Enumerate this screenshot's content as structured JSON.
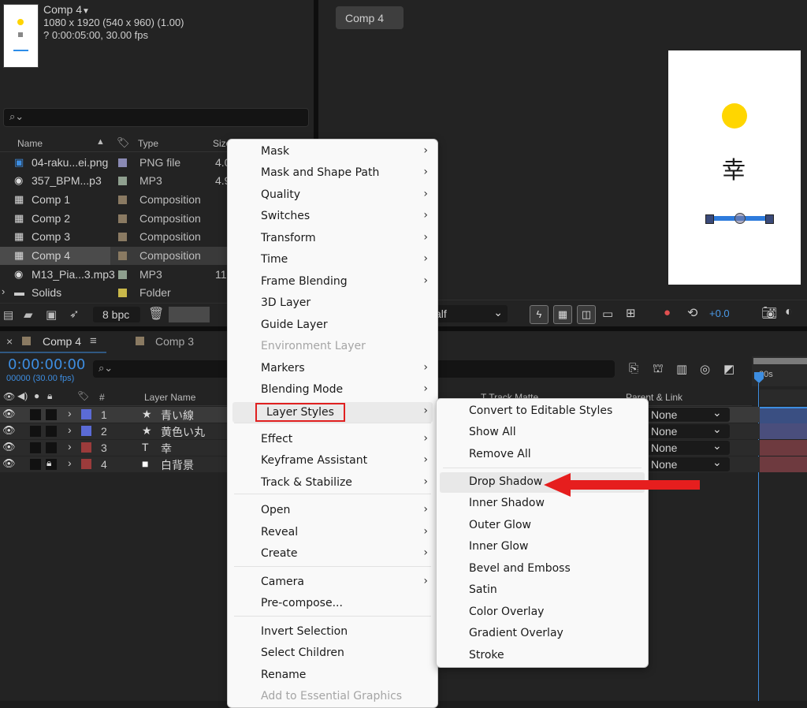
{
  "project": {
    "comp_name": "Comp 4",
    "comp_line1": "1080 x 1920  (540 x 960) (1.00)",
    "comp_line2": "? 0:00:05:00, 30.00 fps",
    "columns": {
      "name": "Name",
      "type": "Type",
      "size": "Size"
    },
    "items": [
      {
        "name": "04-raku...ei.png",
        "type": "PNG file",
        "size": "4.0",
        "swatch": "#8a8ab4",
        "icon": "png-file-icon"
      },
      {
        "name": "357_BPM...p3",
        "type": "MP3",
        "size": "4.9",
        "swatch": "#8fa08f",
        "icon": "audio-file-icon"
      },
      {
        "name": "Comp 1",
        "type": "Composition",
        "size": "",
        "swatch": "#8a7a62",
        "icon": "composition-icon"
      },
      {
        "name": "Comp 2",
        "type": "Composition",
        "size": "",
        "swatch": "#8a7a62",
        "icon": "composition-icon"
      },
      {
        "name": "Comp 3",
        "type": "Composition",
        "size": "",
        "swatch": "#8a7a62",
        "icon": "composition-icon"
      },
      {
        "name": "Comp 4",
        "type": "Composition",
        "size": "",
        "swatch": "#8a7a62",
        "icon": "composition-icon"
      },
      {
        "name": "M13_Pia...3.mp3",
        "type": "MP3",
        "size": "11",
        "swatch": "#8fa08f",
        "icon": "audio-file-icon"
      },
      {
        "name": "Solids",
        "type": "Folder",
        "size": "",
        "swatch": "#c9b84a",
        "icon": "folder-icon"
      }
    ],
    "bpc": "8 bpc"
  },
  "viewer": {
    "tab": "Comp 4",
    "glyph": "幸",
    "resolution": "alf",
    "exposure": "+0.0"
  },
  "timeline": {
    "tabs": [
      "Comp 4",
      "Comp 3"
    ],
    "timecode": "0:00:00:00",
    "frames": "00000 (30.00 fps)",
    "ruler_label": "00s",
    "headers": {
      "num": "#",
      "layer_name": "Layer Name",
      "track_matte": "T  Track Matte",
      "parent": "Parent & Link"
    },
    "layers": [
      {
        "num": "1",
        "name": "青い線",
        "label": "#5b6bd6",
        "type_icon": "star-icon",
        "parent": "None",
        "bar": "#3a4f82"
      },
      {
        "num": "2",
        "name": "黄色い丸",
        "label": "#5b6bd6",
        "type_icon": "star-icon",
        "parent": "None",
        "bar": "#4a4e7c"
      },
      {
        "num": "3",
        "name": "幸",
        "label": "#9b3b3b",
        "type_icon": "text-icon",
        "parent": "None",
        "bar": "#6e3a3f"
      },
      {
        "num": "4",
        "name": "白背景",
        "label": "#9b3b3b",
        "type_icon": "solid-icon",
        "parent": "None",
        "bar": "#6e3a3f"
      }
    ]
  },
  "context_menu": {
    "items": [
      {
        "label": "Mask",
        "sub": true
      },
      {
        "label": "Mask and Shape Path",
        "sub": true
      },
      {
        "label": "Quality",
        "sub": true
      },
      {
        "label": "Switches",
        "sub": true
      },
      {
        "label": "Transform",
        "sub": true
      },
      {
        "label": "Time",
        "sub": true
      },
      {
        "label": "Frame Blending",
        "sub": true
      },
      {
        "label": "3D Layer",
        "sub": false
      },
      {
        "label": "Guide Layer",
        "sub": false
      },
      {
        "label": "Environment Layer",
        "sub": false,
        "disabled": true
      },
      {
        "label": "Markers",
        "sub": true
      },
      {
        "label": "Blending Mode",
        "sub": true
      },
      {
        "label": "Layer Styles",
        "sub": true,
        "highlight": true
      },
      {
        "label": "Effect",
        "sub": true
      },
      {
        "label": "Keyframe Assistant",
        "sub": true
      },
      {
        "label": "Track & Stabilize",
        "sub": true
      },
      {
        "label": "Open",
        "sub": true
      },
      {
        "label": "Reveal",
        "sub": true
      },
      {
        "label": "Create",
        "sub": true
      },
      {
        "label": "Camera",
        "sub": true
      },
      {
        "label": "Pre-compose...",
        "sub": false
      },
      {
        "label": "Invert Selection",
        "sub": false
      },
      {
        "label": "Select Children",
        "sub": false
      },
      {
        "label": "Rename",
        "sub": false
      },
      {
        "label": "Add to Essential Graphics",
        "sub": false,
        "disabled": true
      }
    ]
  },
  "layer_styles_menu": {
    "items": [
      {
        "label": "Convert to Editable Styles"
      },
      {
        "label": "Show All"
      },
      {
        "label": "Remove All"
      },
      {
        "label": "Drop Shadow",
        "hover": true
      },
      {
        "label": "Inner Shadow"
      },
      {
        "label": "Outer Glow"
      },
      {
        "label": "Inner Glow"
      },
      {
        "label": "Bevel and Emboss"
      },
      {
        "label": "Satin"
      },
      {
        "label": "Color Overlay"
      },
      {
        "label": "Gradient Overlay"
      },
      {
        "label": "Stroke"
      }
    ]
  },
  "colors": {
    "accent": "#3d8de0",
    "highlight_box": "#e02020",
    "annotation_arrow": "#e61e1e"
  }
}
